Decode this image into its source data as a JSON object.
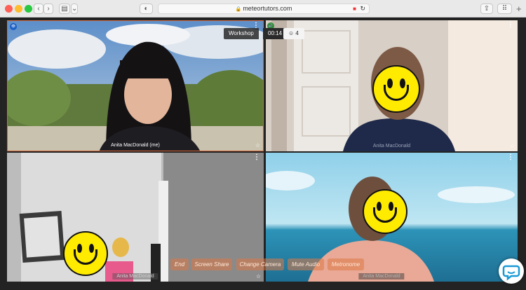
{
  "browser": {
    "url": "meteortutors.com"
  },
  "session": {
    "title": "Workshop",
    "timer": "00:14",
    "participants_count": "4",
    "participants_icon": "people-icon"
  },
  "tiles": [
    {
      "name": "Anita MacDonald (me)",
      "star": "☆",
      "menu": "⋮",
      "badge": "👁"
    },
    {
      "name": "Anita MacDonald",
      "star": "☆",
      "menu": "⋮",
      "badge": "🔊"
    },
    {
      "name": "Anita MacDonald",
      "star": "☆",
      "menu": "⋮"
    },
    {
      "name": "Anita MacDonald",
      "star": "☆",
      "menu": "⋮"
    }
  ],
  "controls": {
    "end": "End",
    "screen_share": "Screen Share",
    "change_camera": "Change Camera",
    "mute_audio": "Mute Audio",
    "metronome": "Metronome"
  },
  "colors": {
    "active_border": "#d76a3c",
    "controls": "#dc7846",
    "smiley": "#ffeb00"
  }
}
